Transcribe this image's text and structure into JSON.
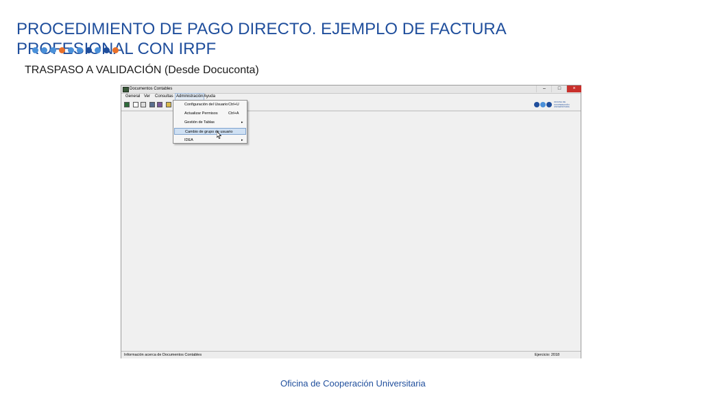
{
  "slide": {
    "title": "PROCEDIMIENTO DE PAGO DIRECTO. EJEMPLO DE FACTURA PROFESIONAL CON IRPF",
    "subtitle": "TRASPASO A VALIDACIÓN (Desde Docuconta)",
    "footer": "Oficina de Cooperación Universitaria",
    "dot_colors": [
      "#4a90d9",
      "#4a90d9",
      "#4a90d9",
      "#e8702a",
      "#4a90d9",
      "#4a90d9",
      "#1f4e9c",
      "#4a90d9",
      "#1f4e9c",
      "#e8702a"
    ]
  },
  "window": {
    "title": "Documentos Contables",
    "controls": {
      "minimize": "–",
      "maximize": "□",
      "close": "×"
    },
    "close_color": "#c9302c"
  },
  "menubar": {
    "items": [
      {
        "label": "General"
      },
      {
        "label": "Ver"
      },
      {
        "label": "Consultas"
      },
      {
        "label": "Administración",
        "open": true
      },
      {
        "label": "Ayuda"
      }
    ]
  },
  "toolbar": {
    "icons": [
      "users-icon",
      "new-document-icon",
      "documents-icon",
      "save-icon",
      "report-icon",
      "key-icon"
    ]
  },
  "dropdown": {
    "items": [
      {
        "label": "Configuración del Usuario",
        "shortcut": "Ctrl+U",
        "arrow": ""
      },
      {
        "label": "Actualizar Permisos",
        "shortcut": "Ctrl+A",
        "arrow": ""
      },
      {
        "label": "Gestión de Tablas",
        "shortcut": "",
        "arrow": "▸"
      },
      {
        "label": "Cambio de grupo de usuario",
        "shortcut": "",
        "arrow": "",
        "highlighted": true
      },
      {
        "label": "IDEA",
        "shortcut": "",
        "arrow": "▸"
      }
    ]
  },
  "statusbar": {
    "left": "Información acerca de Documentos Contables",
    "right": "Ejercicio: 2018"
  },
  "brand_colors": {
    "primary": "#1f4e9c",
    "accent": "#4a90d9",
    "orange": "#e8702a"
  }
}
